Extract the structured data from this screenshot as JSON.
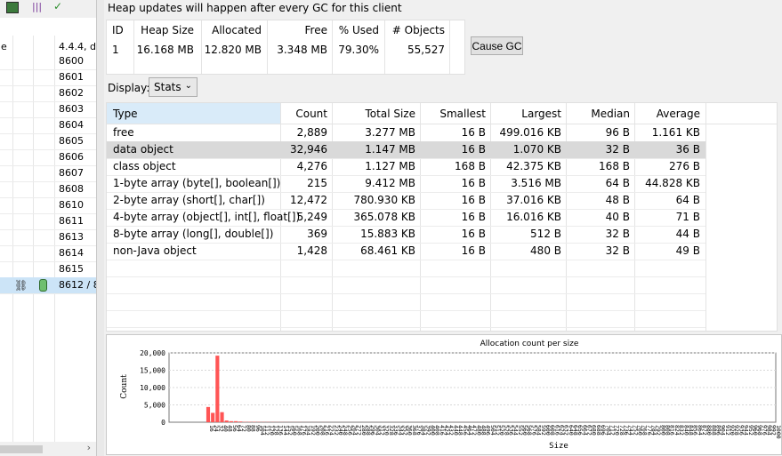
{
  "left_pane": {
    "header_label": "4.4.4, d",
    "ports": [
      "8600",
      "8601",
      "8602",
      "8603",
      "8604",
      "8605",
      "8606",
      "8607",
      "8608",
      "8610",
      "8611",
      "8613",
      "8614",
      "8615"
    ],
    "selected_port": "8612 / 8",
    "row_label_fragment": "e"
  },
  "heap": {
    "notice": "Heap updates will happen after every GC for this client",
    "info_columns": [
      "ID",
      "Heap Size",
      "Allocated",
      "Free",
      "% Used",
      "# Objects"
    ],
    "info_values": [
      "1",
      "16.168 MB",
      "12.820 MB",
      "3.348 MB",
      "79.30%",
      "55,527"
    ],
    "cause_gc_label": "Cause GC",
    "display_label": "Display:",
    "display_value": "Stats"
  },
  "stats_table": {
    "columns": [
      "Type",
      "Count",
      "Total Size",
      "Smallest",
      "Largest",
      "Median",
      "Average"
    ],
    "rows": [
      [
        "free",
        "2,889",
        "3.277 MB",
        "16 B",
        "499.016 KB",
        "96 B",
        "1.161 KB"
      ],
      [
        "data object",
        "32,946",
        "1.147 MB",
        "16 B",
        "1.070 KB",
        "32 B",
        "36 B"
      ],
      [
        "class object",
        "4,276",
        "1.127 MB",
        "168 B",
        "42.375 KB",
        "168 B",
        "276 B"
      ],
      [
        "1-byte array (byte[], boolean[])",
        "215",
        "9.412 MB",
        "16 B",
        "3.516 MB",
        "64 B",
        "44.828 KB"
      ],
      [
        "2-byte array (short[], char[])",
        "12,472",
        "780.930 KB",
        "16 B",
        "37.016 KB",
        "48 B",
        "64 B"
      ],
      [
        "4-byte array (object[], int[], float[])",
        "5,249",
        "365.078 KB",
        "16 B",
        "16.016 KB",
        "40 B",
        "71 B"
      ],
      [
        "8-byte array (long[], double[])",
        "369",
        "15.883 KB",
        "16 B",
        "512 B",
        "32 B",
        "44 B"
      ],
      [
        "non-Java object",
        "1,428",
        "68.461 KB",
        "16 B",
        "480 B",
        "32 B",
        "49 B"
      ]
    ],
    "selected_row": 1
  },
  "chart_data": {
    "type": "bar",
    "title": "Allocation count per size",
    "xlabel": "Size",
    "ylabel": "Count",
    "yticks": [
      "0",
      "5,000",
      "10,000",
      "15,000",
      "20,000"
    ],
    "ylim": [
      0,
      20000
    ],
    "categories": [
      "16",
      "24",
      "32",
      "40",
      "48",
      "56",
      "64",
      "72",
      "80",
      "88",
      "96",
      "104",
      "112",
      "120",
      "128",
      "136",
      "144",
      "152",
      "160",
      "168",
      "176",
      "184",
      "192",
      "200",
      "208",
      "216",
      "224",
      "232",
      "240",
      "248",
      "256",
      "264",
      "272",
      "280",
      "288",
      "296",
      "304",
      "312",
      "320",
      "328",
      "336",
      "344",
      "352",
      "360",
      "368",
      "376",
      "384",
      "392",
      "400",
      "408",
      "416",
      "424",
      "432",
      "440",
      "448",
      "456",
      "464",
      "472",
      "480",
      "488",
      "496",
      "504",
      "512",
      "520",
      "528",
      "536",
      "544",
      "552",
      "560",
      "568",
      "576",
      "584",
      "592",
      "600",
      "608",
      "616",
      "624",
      "632",
      "640",
      "648",
      "656",
      "664",
      "672",
      "680",
      "688",
      "696",
      "704",
      "712",
      "720",
      "728",
      "736",
      "744",
      "752",
      "760",
      "768",
      "776",
      "784",
      "792",
      "800",
      "808",
      "816",
      "824",
      "832",
      "840",
      "848",
      "856",
      "864",
      "872",
      "880",
      "888",
      "896",
      "904",
      "912",
      "920",
      "928",
      "936",
      "944",
      "952",
      "960",
      "968",
      "976",
      "984",
      "992",
      "1000"
    ],
    "values": [
      4400,
      2700,
      19200,
      2900,
      500,
      300,
      300,
      200,
      100,
      100,
      100,
      80,
      60,
      60,
      50,
      40,
      40,
      30,
      30,
      30,
      30,
      20,
      20,
      20,
      20,
      20,
      20,
      10,
      10,
      10,
      10,
      10,
      10,
      10,
      10,
      10,
      10,
      10,
      10,
      10,
      10,
      10,
      10,
      10,
      10,
      10,
      10,
      10,
      10,
      10,
      10,
      10,
      10,
      10,
      10,
      10,
      10,
      10,
      10,
      10,
      10,
      10,
      10,
      10,
      10,
      10,
      10,
      10,
      10,
      10,
      10,
      10,
      10,
      10,
      10,
      10,
      10,
      10,
      10,
      10,
      10,
      10,
      10,
      10,
      10,
      10,
      10,
      10,
      10,
      10,
      10,
      10,
      10,
      10,
      10,
      10,
      10,
      10,
      10,
      10,
      10,
      10,
      10,
      10,
      10,
      10,
      10,
      10,
      10,
      10,
      10,
      10,
      10,
      10,
      10,
      10,
      10,
      10,
      10,
      10,
      10,
      10,
      10,
      10
    ],
    "bar_color": "#ff5555"
  }
}
